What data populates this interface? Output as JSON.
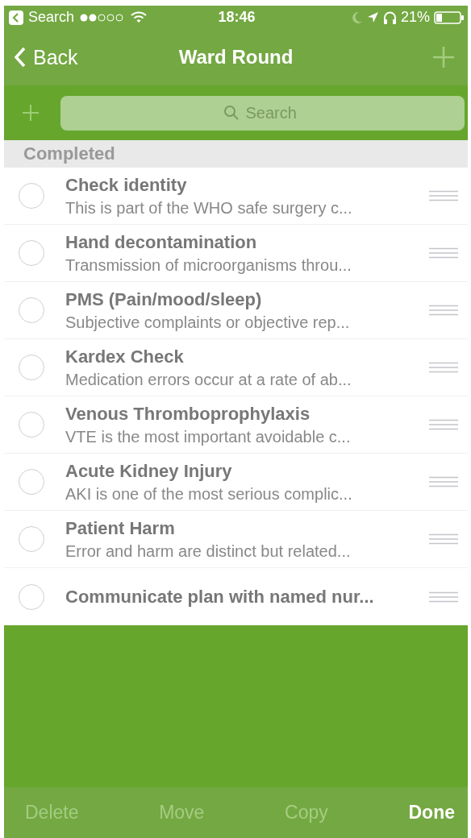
{
  "status_bar": {
    "back_app": "Search",
    "time": "18:46",
    "battery": "21%"
  },
  "nav": {
    "back": "Back",
    "title": "Ward Round"
  },
  "search": {
    "placeholder": "Search"
  },
  "section": "Completed",
  "items": [
    {
      "title": "Check identity",
      "subtitle": "This is part of the WHO safe surgery c...",
      "checked": false
    },
    {
      "title": "Hand decontamination",
      "subtitle": "Transmission of microorganisms throu...",
      "checked": false
    },
    {
      "title": "PMS (Pain/mood/sleep)",
      "subtitle": "Subjective complaints or objective rep...",
      "checked": false
    },
    {
      "title": "Kardex Check",
      "subtitle": "Medication errors occur at a rate of ab...",
      "checked": false
    },
    {
      "title": "Venous Thromboprophylaxis",
      "subtitle": "VTE is the most important avoidable c...",
      "checked": false
    },
    {
      "title": "Acute Kidney Injury",
      "subtitle": "AKI is one of the most serious complic...",
      "checked": false
    },
    {
      "title": "Patient Harm",
      "subtitle": "Error and harm are distinct but related...",
      "checked": false
    },
    {
      "title": "Communicate plan with named nur...",
      "checked": false
    }
  ],
  "toolbar": [
    {
      "label": "Delete",
      "disabled": true
    },
    {
      "label": "Move",
      "disabled": true
    },
    {
      "label": "Copy",
      "disabled": true
    },
    {
      "label": "Done",
      "disabled": false
    }
  ]
}
